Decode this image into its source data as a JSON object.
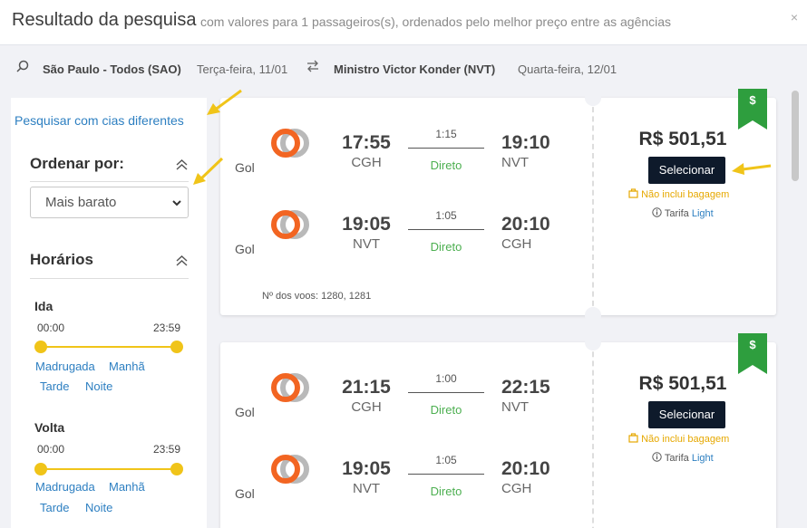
{
  "header": {
    "title": "Resultado da pesquisa",
    "subtitle": "com valores para 1 passageiros(s), ordenados pelo melhor preço entre as agências",
    "close": "×"
  },
  "route": {
    "origin": "São Paulo - Todos (SAO)",
    "origin_date": "Terça-feira, 11/01",
    "destination": "Ministro Victor Konder (NVT)",
    "destination_date": "Quarta-feira, 12/01"
  },
  "sidebar": {
    "different_airlines_link": "Pesquisar com cias diferentes",
    "sort_title": "Ordenar por:",
    "sort_value": "Mais barato",
    "schedule_title": "Horários",
    "outbound": {
      "label": "Ida",
      "min": "00:00",
      "max": "23:59",
      "periods": [
        "Madrugada",
        "Manhã",
        "Tarde",
        "Noite"
      ]
    },
    "return": {
      "label": "Volta",
      "min": "00:00",
      "max": "23:59",
      "periods": [
        "Madrugada",
        "Manhã",
        "Tarde",
        "Noite"
      ]
    }
  },
  "results": [
    {
      "legs": [
        {
          "airline": "Gol",
          "dep_time": "17:55",
          "dep_airport": "CGH",
          "duration": "1:15",
          "stops": "Direto",
          "arr_time": "19:10",
          "arr_airport": "NVT"
        },
        {
          "airline": "Gol",
          "dep_time": "19:05",
          "dep_airport": "NVT",
          "duration": "1:05",
          "stops": "Direto",
          "arr_time": "20:10",
          "arr_airport": "CGH"
        }
      ],
      "flight_numbers": "Nº dos voos: 1280, 1281",
      "price": "R$ 501,51",
      "select_label": "Selecionar",
      "baggage": "Não inclui bagagem",
      "fare_prefix": "Tarifa",
      "fare_name": "Light",
      "badge": "$"
    },
    {
      "legs": [
        {
          "airline": "Gol",
          "dep_time": "21:15",
          "dep_airport": "CGH",
          "duration": "1:00",
          "stops": "Direto",
          "arr_time": "22:15",
          "arr_airport": "NVT"
        },
        {
          "airline": "Gol",
          "dep_time": "19:05",
          "dep_airport": "NVT",
          "duration": "1:05",
          "stops": "Direto",
          "arr_time": "20:10",
          "arr_airport": "CGH"
        }
      ],
      "price": "R$ 501,51",
      "select_label": "Selecionar",
      "baggage": "Não inclui bagagem",
      "fare_prefix": "Tarifa",
      "fare_name": "Light",
      "badge": "$"
    }
  ],
  "colors": {
    "accent_link": "#2d7fc1",
    "slider": "#f0c419",
    "select_button": "#0e1a2b",
    "direct": "#4caf50",
    "badge": "#2e9e3e",
    "gol_orange": "#f26522",
    "annotation_arrow": "#f0c419"
  },
  "icons": {
    "search": "search-icon",
    "swap": "swap-icon",
    "chevron_up": "chevron-up-icon",
    "luggage": "luggage-icon",
    "info": "info-icon"
  }
}
